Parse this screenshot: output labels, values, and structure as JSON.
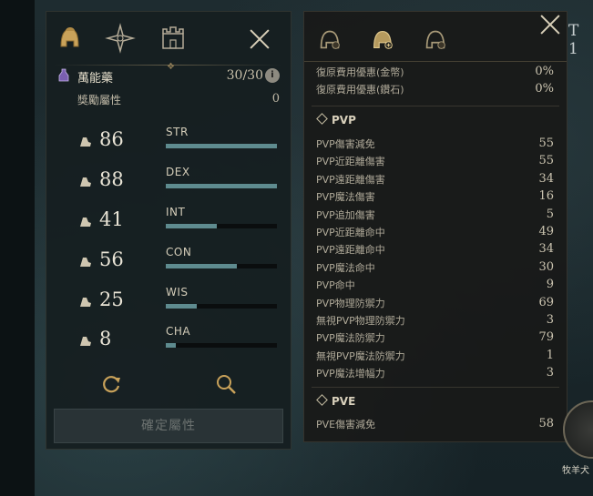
{
  "left": {
    "potion": {
      "name": "萬能藥",
      "count": "30/30",
      "info": "i"
    },
    "bonus": {
      "label": "獎勵屬性",
      "value": "0"
    },
    "stats": [
      {
        "label": "STR",
        "value": "86",
        "fill": 1.0,
        "icon": "strength-arm-icon"
      },
      {
        "label": "DEX",
        "value": "88",
        "fill": 1.0,
        "icon": "dexterity-boot-icon"
      },
      {
        "label": "INT",
        "value": "41",
        "fill": 0.46,
        "icon": "intelligence-book-icon"
      },
      {
        "label": "CON",
        "value": "56",
        "fill": 0.64,
        "icon": "constitution-heart-icon"
      },
      {
        "label": "WIS",
        "value": "25",
        "fill": 0.28,
        "icon": "wisdom-head-icon"
      },
      {
        "label": "CHA",
        "value": "8",
        "fill": 0.09,
        "icon": "charisma-crown-icon"
      }
    ],
    "confirm": "確定屬性"
  },
  "right": {
    "top_rows": [
      {
        "label": "復原費用優惠(金幣)",
        "value": "0%"
      },
      {
        "label": "復原費用優惠(鑽石)",
        "value": "0%"
      }
    ],
    "pvp_title": "PVP",
    "pvp_rows": [
      {
        "label": "PVP傷害減免",
        "value": "55"
      },
      {
        "label": "PVP近距離傷害",
        "value": "55"
      },
      {
        "label": "PVP遠距離傷害",
        "value": "34"
      },
      {
        "label": "PVP魔法傷害",
        "value": "16"
      },
      {
        "label": "PVP追加傷害",
        "value": "5"
      },
      {
        "label": "PVP近距離命中",
        "value": "49"
      },
      {
        "label": "PVP遠距離命中",
        "value": "34"
      },
      {
        "label": "PVP魔法命中",
        "value": "30"
      },
      {
        "label": "PVP命中",
        "value": "9"
      },
      {
        "label": "PVP物理防禦力",
        "value": "69"
      },
      {
        "label": "無視PVP物理防禦力",
        "value": "3"
      },
      {
        "label": "PVP魔法防禦力",
        "value": "79"
      },
      {
        "label": "無視PVP魔法防禦力",
        "value": "1"
      },
      {
        "label": "PVP魔法增幅力",
        "value": "3"
      }
    ],
    "pve_title": "PVE",
    "pve_rows": [
      {
        "label": "PVE傷害減免",
        "value": "58"
      }
    ]
  },
  "hud": {
    "t1": "T 1",
    "map_label": "牧羊犬"
  },
  "colors": {
    "bar_fill": "#5e8b8f",
    "accent": "#c8bfa5"
  }
}
